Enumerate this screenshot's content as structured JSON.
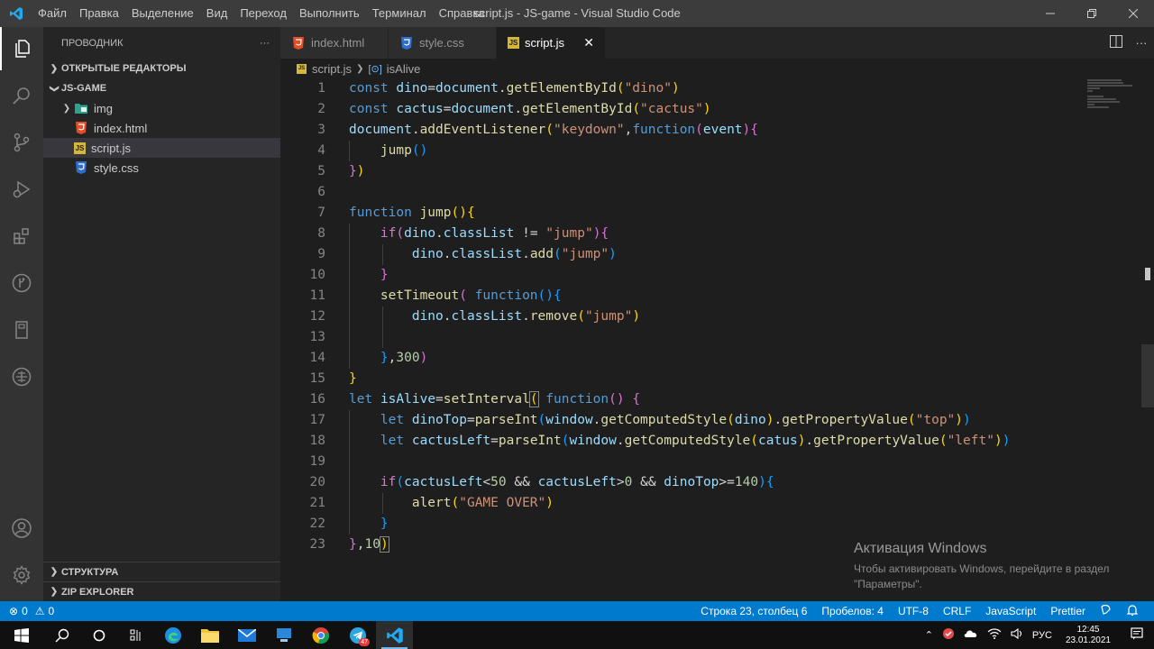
{
  "window": {
    "title": "script.js - JS-game - Visual Studio Code",
    "menu": [
      "Файл",
      "Правка",
      "Выделение",
      "Вид",
      "Переход",
      "Выполнить",
      "Терминал",
      "Справка"
    ]
  },
  "sidebar": {
    "title": "ПРОВОДНИК",
    "more": "···",
    "open_editors": "ОТКРЫТЫЕ РЕДАКТОРЫ",
    "project": "JS-GAME",
    "items": [
      {
        "label": "img",
        "type": "folder"
      },
      {
        "label": "index.html",
        "type": "html"
      },
      {
        "label": "script.js",
        "type": "js"
      },
      {
        "label": "style.css",
        "type": "css"
      }
    ],
    "outline": "СТРУКТУРА",
    "zip_explorer": "ZIP EXPLORER"
  },
  "tabs": [
    {
      "label": "index.html",
      "type": "html"
    },
    {
      "label": "style.css",
      "type": "css"
    },
    {
      "label": "script.js",
      "type": "js",
      "close": "✕"
    }
  ],
  "breadcrumb": {
    "file": "script.js",
    "symbol": "isAlive"
  },
  "code": {
    "line_numbers": [
      "1",
      "2",
      "3",
      "4",
      "5",
      "6",
      "7",
      "8",
      "9",
      "10",
      "11",
      "12",
      "13",
      "14",
      "15",
      "16",
      "17",
      "18",
      "19",
      "20",
      "21",
      "22",
      "23"
    ]
  },
  "watermark": {
    "title": "Активация Windows",
    "line1": "Чтобы активировать Windows, перейдите в раздел",
    "line2": "\"Параметры\"."
  },
  "statusbar": {
    "errors": "0",
    "warnings": "0",
    "position": "Строка 23, столбец 6",
    "spaces": "Пробелов: 4",
    "encoding": "UTF-8",
    "eol": "CRLF",
    "language": "JavaScript",
    "formatter": "Prettier"
  },
  "taskbar": {
    "language": "РУС",
    "time": "12:45",
    "date": "23.01.2021",
    "telegram_badge": "47"
  },
  "colors": {
    "accent": "#007acc",
    "keyword": "#569cd6",
    "control": "#c586c0",
    "function": "#dcdcaa",
    "variable": "#9cdcfe",
    "string": "#ce9178",
    "number": "#b5cea8"
  }
}
